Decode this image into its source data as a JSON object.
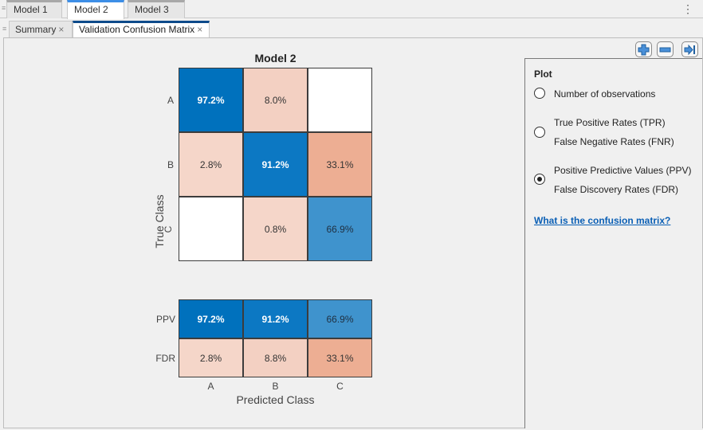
{
  "doc_tabs": [
    {
      "label": "Model 1",
      "active": false
    },
    {
      "label": "Model 2",
      "active": true
    },
    {
      "label": "Model 3",
      "active": false
    }
  ],
  "sub_tabs": [
    {
      "label": "Summary",
      "close": "×",
      "active": false
    },
    {
      "label": "Validation Confusion Matrix",
      "close": "×",
      "active": true
    }
  ],
  "menu_icon": "⋮",
  "toolbar": {
    "zoom_in_icon": "plus-icon",
    "zoom_out_icon": "minus-icon",
    "collapse_icon": "arrow-to-right-icon"
  },
  "chart_data": {
    "type": "heatmap",
    "title": "Model 2",
    "xlabel": "Predicted Class",
    "ylabel": "True Class",
    "row_labels": [
      "A",
      "B",
      "C"
    ],
    "col_labels": [
      "A",
      "B",
      "C"
    ],
    "matrix": [
      [
        "97.2%",
        "8.0%",
        ""
      ],
      [
        "2.8%",
        "91.2%",
        "33.1%"
      ],
      [
        "",
        "0.8%",
        "66.9%"
      ]
    ],
    "matrix_values": [
      [
        97.2,
        8.0,
        null
      ],
      [
        2.8,
        91.2,
        33.1
      ],
      [
        null,
        0.8,
        66.9
      ]
    ],
    "summary_row_labels": [
      "PPV",
      "FDR"
    ],
    "summary": [
      [
        "97.2%",
        "91.2%",
        "66.9%"
      ],
      [
        "2.8%",
        "8.8%",
        "33.1%"
      ]
    ],
    "summary_values": [
      [
        97.2,
        91.2,
        66.9
      ],
      [
        2.8,
        8.8,
        33.1
      ]
    ],
    "colors": {
      "diag_high": "#0071bd",
      "diag_91": "#0c78c3",
      "diag_67": "#3f93cd",
      "off_low": "#f5d6c9",
      "off_8": "#f3d0c2",
      "off_33": "#edae93",
      "empty": "#ffffff"
    }
  },
  "panel": {
    "heading": "Plot",
    "options": [
      {
        "lines": [
          "Number of observations"
        ],
        "checked": false
      },
      {
        "lines": [
          "True Positive Rates (TPR)",
          "False Negative Rates (FNR)"
        ],
        "checked": false
      },
      {
        "lines": [
          "Positive Predictive Values (PPV)",
          "False Discovery Rates (FDR)"
        ],
        "checked": true
      }
    ],
    "help_link": "What is the confusion matrix?"
  }
}
